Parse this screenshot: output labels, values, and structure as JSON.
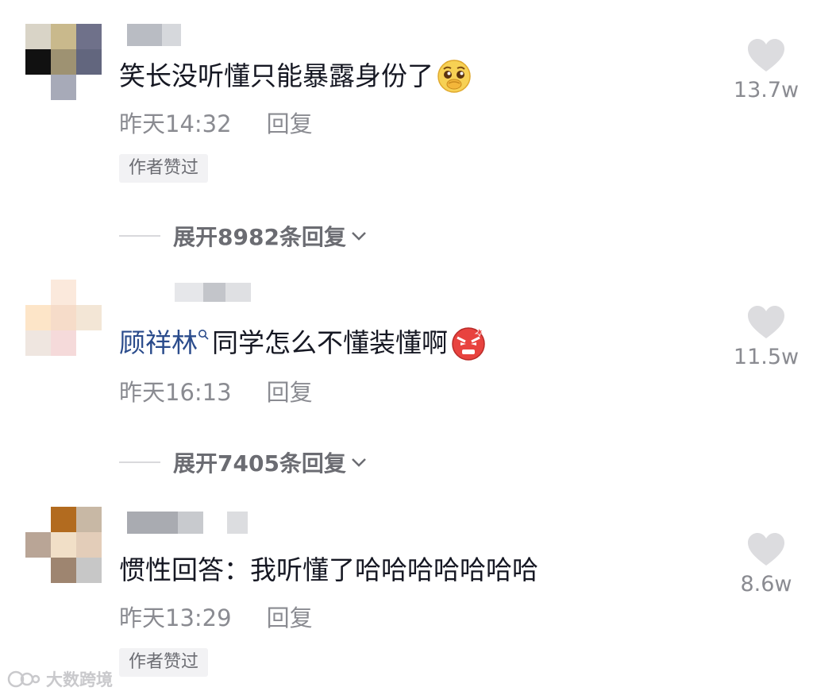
{
  "comments": [
    {
      "text": "笑长没听懂只能暴露身份了",
      "time": "昨天14:32",
      "reply": "回复",
      "badge": "作者赞过",
      "likes": "13.7w",
      "expand": "展开8982条回复",
      "emoji": "pleading-face-icon"
    },
    {
      "mention": "顾祥林",
      "text": "同学怎么不懂装懂啊",
      "time": "昨天16:13",
      "reply": "回复",
      "likes": "11.5w",
      "expand": "展开7405条回复",
      "emoji": "angry-face-icon"
    },
    {
      "text": "惯性回答：我听懂了哈哈哈哈哈哈哈",
      "time": "昨天13:29",
      "reply": "回复",
      "badge": "作者赞过",
      "likes": "8.6w"
    }
  ],
  "watermark": {
    "text": "大数跨境"
  },
  "colors": {
    "mention": "#2b4c8c",
    "meta": "#8a8b91",
    "heart": "#dcdcdf"
  }
}
